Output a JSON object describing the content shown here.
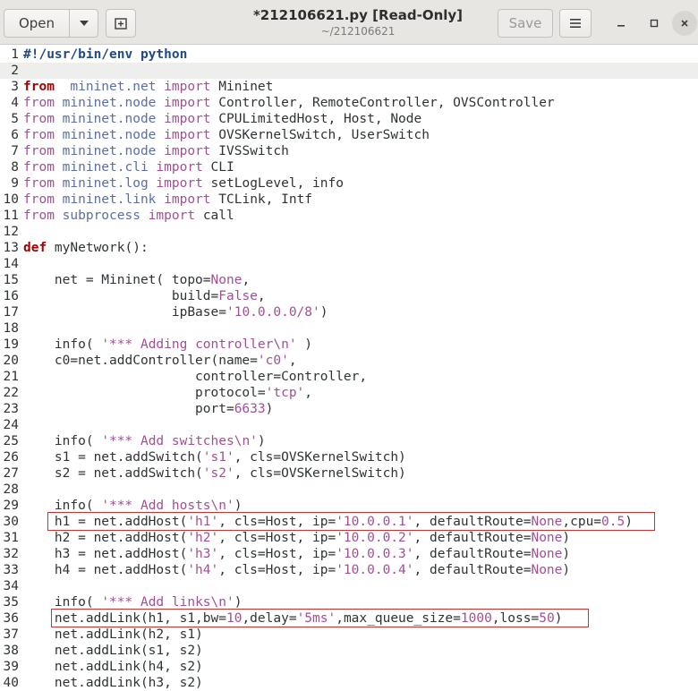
{
  "header": {
    "open_label": "Open",
    "title": "*212106621.py [Read-Only]",
    "subtitle": "~/212106621",
    "save_label": "Save"
  },
  "icons": {
    "dropdown": "chevron-down-icon",
    "new_tab": "new-tab-icon",
    "menu": "hamburger-menu-icon",
    "minimize": "minimize-icon",
    "maximize": "maximize-icon",
    "close": "close-icon"
  },
  "colors": {
    "keyword": "#a40000",
    "string": "#a25094",
    "module": "#5a6fa8",
    "highlight_box": "#d0302b"
  },
  "editor": {
    "lines": [
      {
        "n": "1",
        "t": [
          [
            "sh",
            "#!/usr/bin/env python"
          ]
        ]
      },
      {
        "n": "2",
        "t": []
      },
      {
        "n": "3",
        "t": [
          [
            "kw",
            "from"
          ],
          [
            "",
            "  "
          ],
          [
            "mod",
            "mininet.net"
          ],
          [
            "",
            " "
          ],
          [
            "imp",
            "import"
          ],
          [
            "",
            " Mininet"
          ]
        ]
      },
      {
        "n": "4",
        "t": [
          [
            "imp",
            "from"
          ],
          [
            "",
            " "
          ],
          [
            "mod",
            "mininet.node"
          ],
          [
            "",
            " "
          ],
          [
            "imp",
            "import"
          ],
          [
            "",
            " Controller, RemoteController, OVSController"
          ]
        ]
      },
      {
        "n": "5",
        "t": [
          [
            "imp",
            "from"
          ],
          [
            "",
            " "
          ],
          [
            "mod",
            "mininet.node"
          ],
          [
            "",
            " "
          ],
          [
            "imp",
            "import"
          ],
          [
            "",
            " CPULimitedHost, Host, Node"
          ]
        ]
      },
      {
        "n": "6",
        "t": [
          [
            "imp",
            "from"
          ],
          [
            "",
            " "
          ],
          [
            "mod",
            "mininet.node"
          ],
          [
            "",
            " "
          ],
          [
            "imp",
            "import"
          ],
          [
            "",
            " OVSKernelSwitch, UserSwitch"
          ]
        ]
      },
      {
        "n": "7",
        "t": [
          [
            "imp",
            "from"
          ],
          [
            "",
            " "
          ],
          [
            "mod",
            "mininet.node"
          ],
          [
            "",
            " "
          ],
          [
            "imp",
            "import"
          ],
          [
            "",
            " IVSSwitch"
          ]
        ]
      },
      {
        "n": "8",
        "t": [
          [
            "imp",
            "from"
          ],
          [
            "",
            " "
          ],
          [
            "mod",
            "mininet.cli"
          ],
          [
            "",
            " "
          ],
          [
            "imp",
            "import"
          ],
          [
            "",
            " CLI"
          ]
        ]
      },
      {
        "n": "9",
        "t": [
          [
            "imp",
            "from"
          ],
          [
            "",
            " "
          ],
          [
            "mod",
            "mininet.log"
          ],
          [
            "",
            " "
          ],
          [
            "imp",
            "import"
          ],
          [
            "",
            " setLogLevel, info"
          ]
        ]
      },
      {
        "n": "10",
        "t": [
          [
            "imp",
            "from"
          ],
          [
            "",
            " "
          ],
          [
            "mod",
            "mininet.link"
          ],
          [
            "",
            " "
          ],
          [
            "imp",
            "import"
          ],
          [
            "",
            " TCLink, Intf"
          ]
        ]
      },
      {
        "n": "11",
        "t": [
          [
            "imp",
            "from"
          ],
          [
            "",
            " "
          ],
          [
            "mod",
            "subprocess"
          ],
          [
            "",
            " "
          ],
          [
            "imp",
            "import"
          ],
          [
            "",
            " call"
          ]
        ]
      },
      {
        "n": "12",
        "t": []
      },
      {
        "n": "13",
        "t": [
          [
            "kw",
            "def"
          ],
          [
            "",
            " myNetwork():"
          ]
        ]
      },
      {
        "n": "14",
        "t": []
      },
      {
        "n": "15",
        "t": [
          [
            "",
            "    net = Mininet( topo="
          ],
          [
            "str",
            "None"
          ],
          [
            "",
            ","
          ]
        ]
      },
      {
        "n": "16",
        "t": [
          [
            "",
            "                   build="
          ],
          [
            "str",
            "False"
          ],
          [
            "",
            ","
          ]
        ]
      },
      {
        "n": "17",
        "t": [
          [
            "",
            "                   ipBase="
          ],
          [
            "str",
            "'10.0.0.0/8'"
          ],
          [
            "",
            ")"
          ]
        ]
      },
      {
        "n": "18",
        "t": []
      },
      {
        "n": "19",
        "t": [
          [
            "",
            "    info( "
          ],
          [
            "str",
            "'*** Adding controller\\n'"
          ],
          [
            "",
            " )"
          ]
        ]
      },
      {
        "n": "20",
        "t": [
          [
            "",
            "    c0=net.addController(name="
          ],
          [
            "str",
            "'c0'"
          ],
          [
            "",
            ","
          ]
        ]
      },
      {
        "n": "21",
        "t": [
          [
            "",
            "                      controller=Controller,"
          ]
        ]
      },
      {
        "n": "22",
        "t": [
          [
            "",
            "                      protocol="
          ],
          [
            "str",
            "'tcp'"
          ],
          [
            "",
            ","
          ]
        ]
      },
      {
        "n": "23",
        "t": [
          [
            "",
            "                      port="
          ],
          [
            "str",
            "6633"
          ],
          [
            "",
            ")"
          ]
        ]
      },
      {
        "n": "24",
        "t": []
      },
      {
        "n": "25",
        "t": [
          [
            "",
            "    info( "
          ],
          [
            "str",
            "'*** Add switches\\n'"
          ],
          [
            "",
            ")"
          ]
        ]
      },
      {
        "n": "26",
        "t": [
          [
            "",
            "    s1 = net.addSwitch("
          ],
          [
            "str",
            "'s1'"
          ],
          [
            "",
            ", cls=OVSKernelSwitch)"
          ]
        ]
      },
      {
        "n": "27",
        "t": [
          [
            "",
            "    s2 = net.addSwitch("
          ],
          [
            "str",
            "'s2'"
          ],
          [
            "",
            ", cls=OVSKernelSwitch)"
          ]
        ]
      },
      {
        "n": "28",
        "t": []
      },
      {
        "n": "29",
        "t": [
          [
            "",
            "    info( "
          ],
          [
            "str",
            "'*** Add hosts\\n'"
          ],
          [
            "",
            ")"
          ]
        ]
      },
      {
        "n": "30",
        "t": [
          [
            "",
            "    h1 = net.addHost("
          ],
          [
            "str",
            "'h1'"
          ],
          [
            "",
            ", cls=Host, ip="
          ],
          [
            "str",
            "'10.0.0.1'"
          ],
          [
            "",
            ", defaultRoute="
          ],
          [
            "str",
            "None"
          ],
          [
            "",
            ",cpu="
          ],
          [
            "str",
            "0.5"
          ],
          [
            "",
            ")"
          ]
        ]
      },
      {
        "n": "31",
        "t": [
          [
            "",
            "    h2 = net.addHost("
          ],
          [
            "str",
            "'h2'"
          ],
          [
            "",
            ", cls=Host, ip="
          ],
          [
            "str",
            "'10.0.0.2'"
          ],
          [
            "",
            ", defaultRoute="
          ],
          [
            "str",
            "None"
          ],
          [
            "",
            ")"
          ]
        ]
      },
      {
        "n": "32",
        "t": [
          [
            "",
            "    h3 = net.addHost("
          ],
          [
            "str",
            "'h3'"
          ],
          [
            "",
            ", cls=Host, ip="
          ],
          [
            "str",
            "'10.0.0.3'"
          ],
          [
            "",
            ", defaultRoute="
          ],
          [
            "str",
            "None"
          ],
          [
            "",
            ")"
          ]
        ]
      },
      {
        "n": "33",
        "t": [
          [
            "",
            "    h4 = net.addHost("
          ],
          [
            "str",
            "'h4'"
          ],
          [
            "",
            ", cls=Host, ip="
          ],
          [
            "str",
            "'10.0.0.4'"
          ],
          [
            "",
            ", defaultRoute="
          ],
          [
            "str",
            "None"
          ],
          [
            "",
            ")"
          ]
        ]
      },
      {
        "n": "34",
        "t": []
      },
      {
        "n": "35",
        "t": [
          [
            "",
            "    info( "
          ],
          [
            "str",
            "'*** Add links\\n'"
          ],
          [
            "",
            ")"
          ]
        ]
      },
      {
        "n": "36",
        "t": [
          [
            "",
            "    net.addLink(h1, s1,bw="
          ],
          [
            "str",
            "10"
          ],
          [
            "",
            ",delay="
          ],
          [
            "str",
            "'5ms'"
          ],
          [
            "",
            ",max_queue_size="
          ],
          [
            "str",
            "1000"
          ],
          [
            "",
            ",loss="
          ],
          [
            "str",
            "50"
          ],
          [
            "",
            ")"
          ]
        ]
      },
      {
        "n": "37",
        "t": [
          [
            "",
            "    net.addLink(h2, s1)"
          ]
        ]
      },
      {
        "n": "38",
        "t": [
          [
            "",
            "    net.addLink(s1, s2)"
          ]
        ]
      },
      {
        "n": "39",
        "t": [
          [
            "",
            "    net.addLink(h4, s2)"
          ]
        ]
      },
      {
        "n": "40",
        "t": [
          [
            "",
            "    net.addLink(h3, s2)"
          ]
        ]
      }
    ]
  }
}
